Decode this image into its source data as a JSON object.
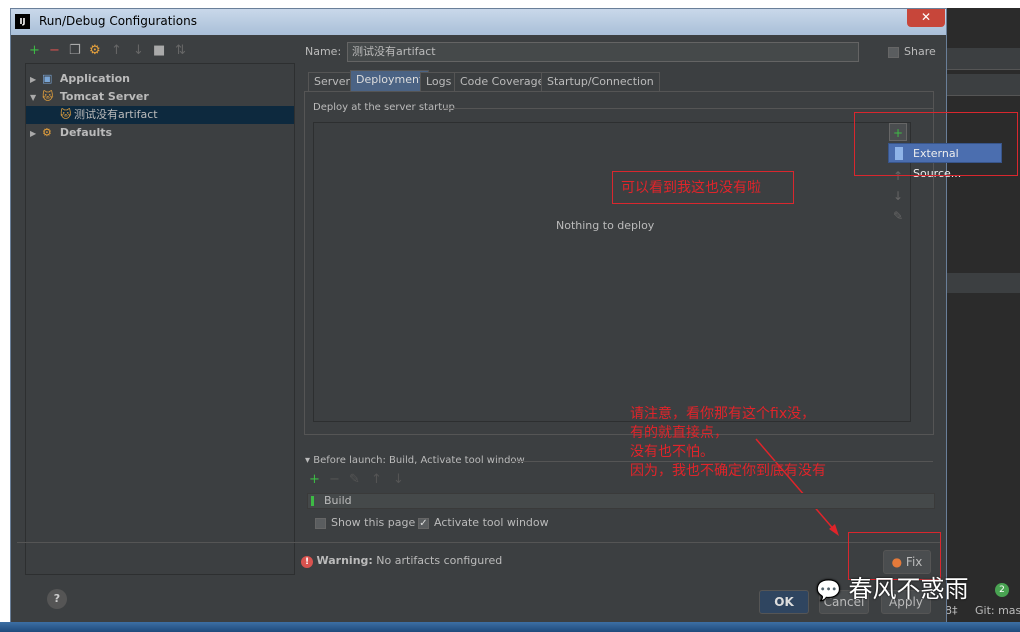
{
  "window": {
    "title": "Run/Debug Configurations",
    "logo": "IJ",
    "close": "✕"
  },
  "toolbar": {
    "icons": [
      "plus-icon",
      "minus-icon",
      "copy-icon",
      "wrench-icon",
      "arrow-up-icon",
      "arrow-down-icon",
      "folder-icon",
      "sort-icon"
    ]
  },
  "tree": [
    {
      "label": "Application",
      "expanded": false
    },
    {
      "label": "Tomcat Server",
      "expanded": true
    },
    {
      "label": "测试没有artifact",
      "selected": true
    },
    {
      "label": "Defaults",
      "expanded": false
    }
  ],
  "name_label": "Name:",
  "name_value": "测试没有artifact",
  "share_label": "Share",
  "tabs": [
    "Server",
    "Deployment",
    "Logs",
    "Code Coverage",
    "Startup/Connection"
  ],
  "active_tab": "Deployment",
  "deploy_group": "Deploy at the server startup",
  "empty_text": "Nothing to deploy",
  "popup_item": "External Source...",
  "annotations": {
    "note1": "可以看到我这也没有啦",
    "note2": [
      "请注意，看你那有这个fix没，",
      "有的就直接点，",
      "没有也不怕。",
      "因为，我也不确定你到底有没有"
    ]
  },
  "before_launch": "Before launch: Build, Activate tool window",
  "build_item": "Build",
  "show_page": "Show this page",
  "activate_tool": "Activate tool window",
  "warning_label": "Warning:",
  "warning_text": "No artifacts configured",
  "fix_label": "Fix",
  "buttons": {
    "ok": "OK",
    "cancel": "Cancel",
    "apply": "Apply"
  },
  "help": "?",
  "watermark": "春风不惑雨",
  "ide_status": {
    "badge": "2",
    "git": "Git: maste",
    "enc": "8‡"
  },
  "colors": {
    "accent": "#4b6eaf",
    "annotation": "#e0242a",
    "add": "#3dbb45"
  }
}
